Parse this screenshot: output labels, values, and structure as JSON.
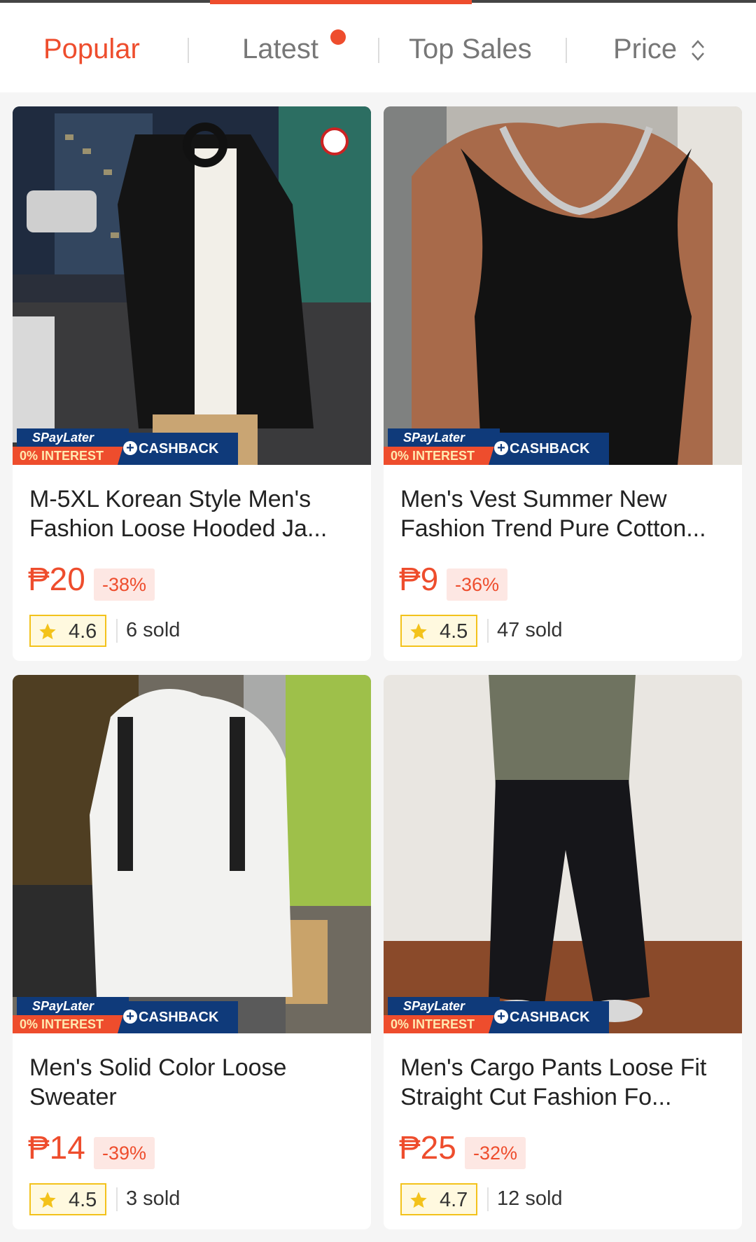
{
  "sort_bar": {
    "tabs": [
      {
        "label": "Popular",
        "active": true
      },
      {
        "label": "Latest",
        "has_new_dot": true
      },
      {
        "label": "Top Sales"
      },
      {
        "label": "Price",
        "icon": "sort-arrows-icon"
      }
    ]
  },
  "promo_badge": {
    "brand": "SPayLater",
    "interest": "0% INTEREST",
    "cashback": "CASHBACK"
  },
  "products": [
    {
      "title": "M-5XL Korean Style Men's Fashion Loose Hooded Ja...",
      "price": "₱20",
      "discount": "-38%",
      "rating": "4.6",
      "sold": "6 sold"
    },
    {
      "title": "Men's Vest Summer New Fashion Trend Pure Cotton...",
      "price": "₱9",
      "discount": "-36%",
      "rating": "4.5",
      "sold": "47 sold"
    },
    {
      "title": "Men's Solid Color Loose Sweater",
      "price": "₱14",
      "discount": "-39%",
      "rating": "4.5",
      "sold": "3 sold"
    },
    {
      "title": "Men's Cargo Pants Loose Fit Straight Cut Fashion Fo...",
      "price": "₱25",
      "discount": "-32%",
      "rating": "4.7",
      "sold": "12 sold"
    }
  ],
  "colors": {
    "accent": "#ee4d2d",
    "promo_navy": "#0f3a7a",
    "star": "#f3c21b"
  }
}
